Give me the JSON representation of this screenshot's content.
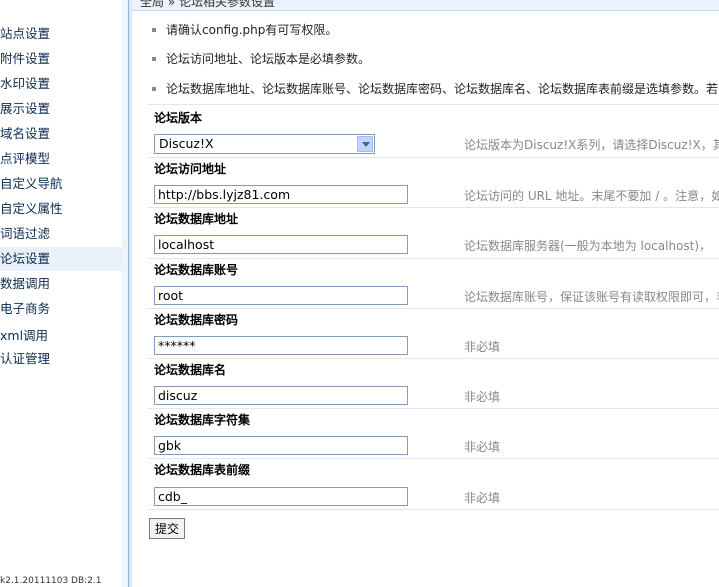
{
  "breadcrumb": "全局 » 论坛相关参数设置",
  "sidebar": {
    "items": [
      {
        "label": "站点设置"
      },
      {
        "label": "附件设置"
      },
      {
        "label": "水印设置"
      },
      {
        "label": "展示设置"
      },
      {
        "label": "域名设置"
      },
      {
        "label": "点评模型"
      },
      {
        "label": "自定义导航"
      },
      {
        "label": "自定义属性"
      },
      {
        "label": "词语过滤"
      },
      {
        "label": "论坛设置"
      },
      {
        "label": "数据调用"
      },
      {
        "label": "电子商务"
      },
      {
        "label": "xml调用"
      },
      {
        "label": "认证管理"
      }
    ],
    "active_item": "论坛设置",
    "footer": "k2.1.20111103 DB:2.1"
  },
  "notes": [
    "请确认config.php有可写权限。",
    "论坛访问地址、论坛版本是必填参数。",
    "论坛数据库地址、论坛数据库账号、论坛数据库密码、论坛数据库名、论坛数据库表前缀是选填参数。若"
  ],
  "form": {
    "version": {
      "label": "论坛版本",
      "value": "Discuz!X",
      "hint": "论坛版本为Discuz!X系列，请选择Discuz!X，其"
    },
    "url": {
      "label": "论坛访问地址",
      "value": "http://bbs.lyjz81.com",
      "hint": "论坛访问的 URL 地址。末尾不要加 / 。注意，如"
    },
    "db_host": {
      "label": "论坛数据库地址",
      "value": "localhost",
      "hint": "论坛数据库服务器(一般为本地为 localhost)，"
    },
    "db_user": {
      "label": "论坛数据库账号",
      "value": "root",
      "hint": "论坛数据库账号，保证该账号有读取权限即可，非"
    },
    "db_pass": {
      "label": "论坛数据库密码",
      "value": "******",
      "hint": "非必填"
    },
    "db_name": {
      "label": "论坛数据库名",
      "value": "discuz",
      "hint": "非必填"
    },
    "db_charset": {
      "label": "论坛数据库字符集",
      "value": "gbk",
      "hint": "非必填"
    },
    "db_prefix": {
      "label": "论坛数据库表前缀",
      "value": "cdb_",
      "hint": "非必填"
    }
  },
  "submit_label": "提交"
}
